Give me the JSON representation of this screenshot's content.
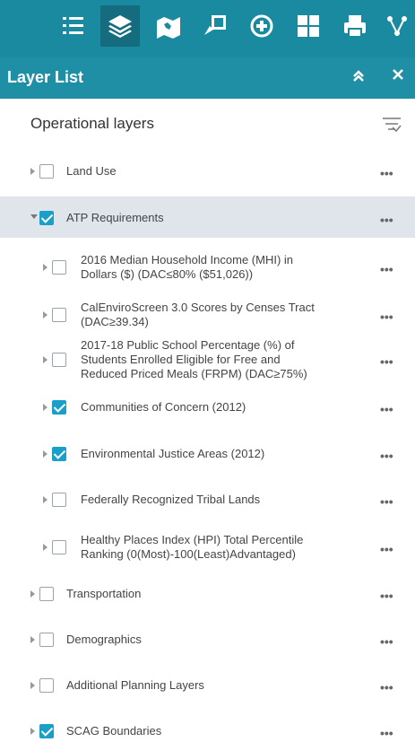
{
  "toolbar": {
    "tools": [
      {
        "name": "list-icon",
        "active": false
      },
      {
        "name": "layers-icon",
        "active": true
      },
      {
        "name": "map-book-icon",
        "active": false
      },
      {
        "name": "draw-icon",
        "active": false
      },
      {
        "name": "measure-icon",
        "active": false
      },
      {
        "name": "grid-icon",
        "active": false
      },
      {
        "name": "print-icon",
        "active": false
      },
      {
        "name": "share-icon",
        "active": false
      }
    ]
  },
  "panel": {
    "title": "Layer List",
    "collapse_icon": "double-chevron-up-icon",
    "close_icon": "close-icon"
  },
  "section": {
    "title": "Operational layers",
    "filter_icon": "filter-icon"
  },
  "layers": [
    {
      "label": "Land Use",
      "checked": false,
      "expanded": false,
      "level": 0
    },
    {
      "label": "ATP Requirements",
      "checked": true,
      "expanded": true,
      "level": 0,
      "selected": true
    },
    {
      "label_lines": [
        "2016 Median Household Income (MHI) in",
        "Dollars ($) (DAC≤80% ($51,026))"
      ],
      "checked": false,
      "level": 1
    },
    {
      "label_lines": [
        "CalEnviroScreen 3.0 Scores by Censes Tract",
        "(DAC≥39.34)"
      ],
      "checked": false,
      "level": 1
    },
    {
      "label_lines": [
        "2017-18 Public School Percentage (%) of",
        "Students Enrolled Eligible for Free and",
        "Reduced Priced Meals (FRPM) (DAC≥75%)"
      ],
      "checked": false,
      "level": 1
    },
    {
      "label": "Communities of Concern (2012)",
      "checked": true,
      "level": 1
    },
    {
      "label": "Environmental Justice Areas (2012)",
      "checked": true,
      "level": 1
    },
    {
      "label": "Federally Recognized Tribal Lands",
      "checked": false,
      "level": 1
    },
    {
      "label_lines": [
        "Healthy Places Index (HPI) Total Percentile",
        "Ranking (0(Most)-100(Least)Advantaged)"
      ],
      "checked": false,
      "level": 1
    },
    {
      "label": "Transportation",
      "checked": false,
      "level": 0
    },
    {
      "label": "Demographics",
      "checked": false,
      "level": 0
    },
    {
      "label": "Additional Planning Layers",
      "checked": false,
      "level": 0
    },
    {
      "label": "SCAG Boundaries",
      "checked": true,
      "level": 0
    }
  ],
  "more_label": "•••"
}
